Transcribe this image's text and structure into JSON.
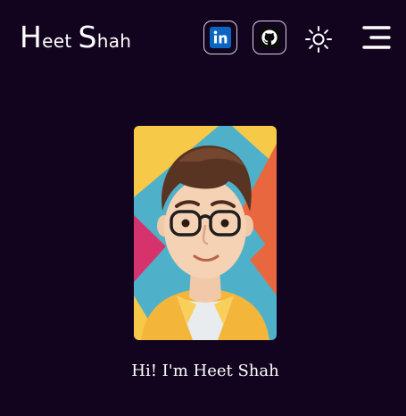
{
  "header": {
    "logo": {
      "first_cap": "H",
      "first_rest": "eet",
      "last_cap": "S",
      "last_rest": "hah"
    },
    "linkedin": {
      "icon": "linkedin-icon",
      "color": "#0a66c2"
    },
    "github": {
      "icon": "github-icon"
    },
    "theme_toggle": {
      "icon": "sun-icon"
    },
    "menu": {
      "icon": "hamburger-menu-icon"
    }
  },
  "hero": {
    "avatar": {
      "icon": "avatar-portrait"
    },
    "greeting": "Hi! I'm Heet Shah"
  },
  "colors": {
    "background": "#12041f",
    "text": "#ffffff",
    "icon_border": "#d6d3dc"
  }
}
